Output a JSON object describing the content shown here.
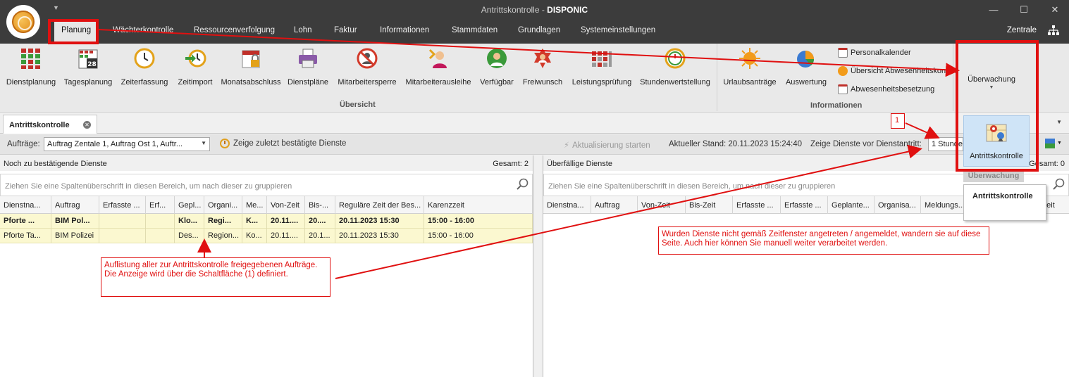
{
  "window": {
    "title_prefix": "Antrittskontrolle - ",
    "title_app": "DISPONIC",
    "minimize": "—",
    "maximize": "☐",
    "close": "✕"
  },
  "menu": {
    "items": [
      "Planung",
      "Wächterkontrolle",
      "Ressourcenverfolgung",
      "Lohn",
      "Faktur",
      "Informationen",
      "Stammdaten",
      "Grundlagen",
      "Systemeinstellungen"
    ],
    "right_label": "Zentrale"
  },
  "ribbon": {
    "uebersicht_buttons": [
      "Dienstplanung",
      "Tagesplanung",
      "Zeiterfassung",
      "Zeitimport",
      "Monatsabschluss",
      "Dienstpläne",
      "Mitarbeitersperre",
      "Mitarbeiterausleihe",
      "Verfügbar",
      "Freiwunsch",
      "Leistungsprüfung",
      "Stundenwertstellung"
    ],
    "uebersicht_label": "Übersicht",
    "info_buttons": [
      "Urlaubsanträge",
      "Auswertung"
    ],
    "info_small": [
      "Personalkalender",
      "Übersicht Abwesenheitskonten",
      "Abwesenheitsbesetzung"
    ],
    "info_label": "Informationen",
    "calendar_day": "28",
    "ueberwachung": "Überwachung"
  },
  "tab": {
    "label": "Antrittskontrolle"
  },
  "toolbar": {
    "auftraege_label": "Aufträge:",
    "auftraege_value": "Auftrag Zentale 1, Auftrag Ost 1, Auftr...",
    "show_last": "Zeige zuletzt bestätigte Dienste",
    "refresh": "Aktualisierung starten",
    "stand": "Aktueller Stand: 20.11.2023 15:24:40",
    "vor_label": "Zeige Dienste vor Dienstantritt:",
    "vor_value": "1 Stunde"
  },
  "left_panel": {
    "title": "Noch zu bestätigende Dienste",
    "total": "Gesamt: 2",
    "group_hint": "Ziehen Sie eine Spaltenüberschrift in diesen Bereich, um nach dieser zu gruppieren",
    "columns": [
      "Dienstna...",
      "Auftrag",
      "Erfasste ...",
      "Erf...",
      "Gepl...",
      "Organi...",
      "Me...",
      "Von-Zeit",
      "Bis-...",
      "Reguläre Zeit der Bes...",
      "Karenzzeit"
    ],
    "rows": [
      [
        "Pforte ...",
        "BIM Pol...",
        "",
        "",
        "Klo...",
        "Regi...",
        "K...",
        "20.11....",
        "20....",
        "20.11.2023 15:30",
        "15:00 - 16:00"
      ],
      [
        "Pforte Ta...",
        "BIM Polizei",
        "",
        "",
        "Des...",
        "Region...",
        "Ko...",
        "20.11....",
        "20.1...",
        "20.11.2023 15:30",
        "15:00 - 16:00"
      ]
    ]
  },
  "right_panel": {
    "title": "Überfällige Dienste",
    "total": "Gesamt: 0",
    "group_hint": "Ziehen Sie eine Spaltenüberschrift in diesen Bereich, um nach dieser zu gruppieren",
    "columns": [
      "Dienstna...",
      "Auftrag",
      "Von-Zeit",
      "Bis-Zeit",
      "Erfasste ...",
      "Erfasste ...",
      "Geplante...",
      "Organisa...",
      "Meldungs...",
      "...eit"
    ]
  },
  "popup": {
    "button": "Antrittskontrolle",
    "caption": "Überwachung",
    "tooltip": "Antrittskontrolle"
  },
  "annotations": {
    "marker": "1",
    "note_left": "Auflistung aller zur Antrittskontrolle freigegebenen Aufträge. Die Anzeige wird über die Schaltfläche (1) definiert.",
    "note_right": "Wurden Dienste nicht gemäß Zeitfenster angetreten / angemeldet, wandern sie auf diese Seite. Auch hier können Sie manuell weiter verarbeitet werden.",
    "color": "#e01010"
  }
}
